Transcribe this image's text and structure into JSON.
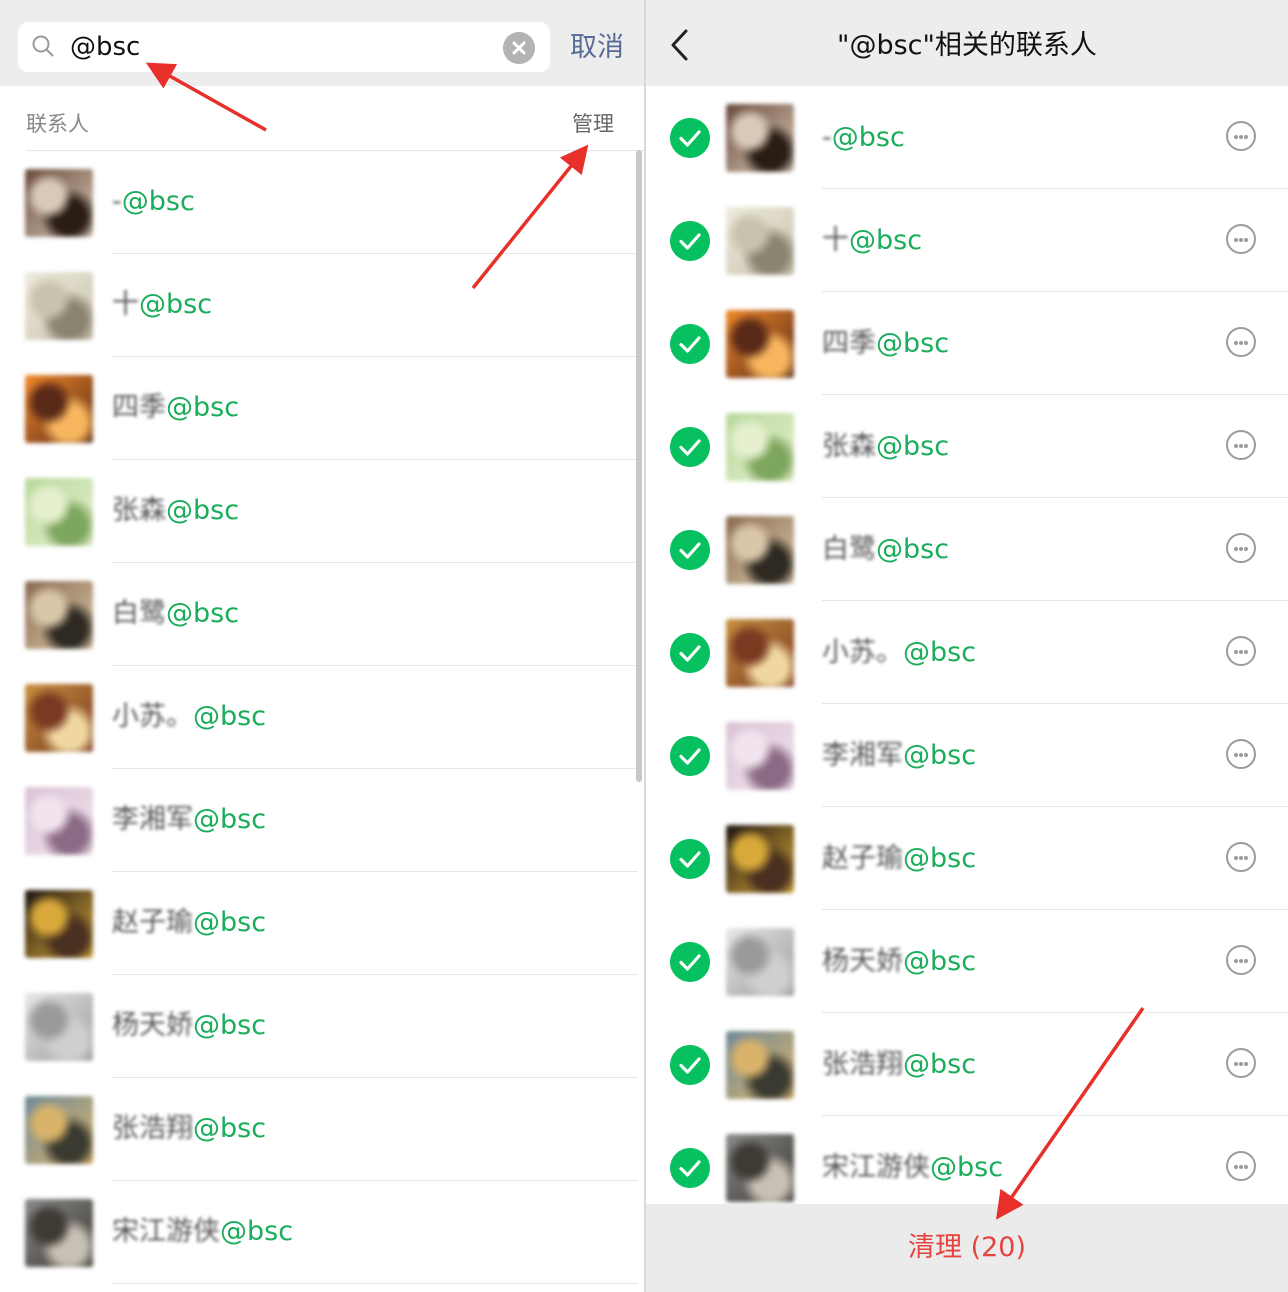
{
  "left": {
    "search": {
      "query": "@bsc",
      "cancel_label": "取消"
    },
    "section": {
      "title": "联系人",
      "manage_label": "管理"
    },
    "contacts": [
      {
        "prefix": "-",
        "match": "@bsc",
        "avatar": [
          "#6a4a3a",
          "#d8c9b8",
          "#2a1d16"
        ]
      },
      {
        "prefix": "十",
        "match": "@bsc",
        "avatar": [
          "#eeeadd",
          "#c9c3ad",
          "#8a8470"
        ]
      },
      {
        "prefix": "四季",
        "match": "@bsc",
        "avatar": [
          "#f0892a",
          "#5a2a18",
          "#f7b55e"
        ]
      },
      {
        "prefix": "张森",
        "match": "@bsc",
        "avatar": [
          "#b7d89a",
          "#e6f0cf",
          "#7da65e"
        ]
      },
      {
        "prefix": "白鹭",
        "match": "@bsc",
        "avatar": [
          "#8a6a4e",
          "#d9c7aa",
          "#2e2a22"
        ]
      },
      {
        "prefix": "小苏。",
        "match": "@bsc",
        "avatar": [
          "#c8903e",
          "#7a3a22",
          "#f0d7a0"
        ]
      },
      {
        "prefix": "李湘军",
        "match": "@bsc",
        "avatar": [
          "#d9c2d4",
          "#f2e4ee",
          "#8b6a85"
        ]
      },
      {
        "prefix": "赵子瑜",
        "match": "@bsc",
        "avatar": [
          "#1c1410",
          "#d8a93a",
          "#4a3020"
        ]
      },
      {
        "prefix": "杨天娇",
        "match": "@bsc",
        "avatar": [
          "#e8e8e8",
          "#9a9a9a",
          "#cfcfcf"
        ]
      },
      {
        "prefix": "张浩翔",
        "match": "@bsc",
        "avatar": [
          "#6f8a9a",
          "#d9b36a",
          "#3a3a30"
        ]
      },
      {
        "prefix": "宋江游侠",
        "match": "@bsc",
        "avatar": [
          "#8a8a8a",
          "#3e3a34",
          "#c7c0b4"
        ]
      }
    ]
  },
  "right": {
    "title": "\"@bsc\"相关的联系人",
    "contacts": [
      {
        "prefix": "-",
        "match": "@bsc",
        "avatar": [
          "#6a4a3a",
          "#d8c9b8",
          "#2a1d16"
        ]
      },
      {
        "prefix": "十",
        "match": "@bsc",
        "avatar": [
          "#eeeadd",
          "#c9c3ad",
          "#8a8470"
        ]
      },
      {
        "prefix": "四季",
        "match": "@bsc",
        "avatar": [
          "#f0892a",
          "#5a2a18",
          "#f7b55e"
        ]
      },
      {
        "prefix": "张森",
        "match": "@bsc",
        "avatar": [
          "#b7d89a",
          "#e6f0cf",
          "#7da65e"
        ]
      },
      {
        "prefix": "白鹭",
        "match": "@bsc",
        "avatar": [
          "#8a6a4e",
          "#d9c7aa",
          "#2e2a22"
        ]
      },
      {
        "prefix": "小苏。",
        "match": "@bsc",
        "avatar": [
          "#c8903e",
          "#7a3a22",
          "#f0d7a0"
        ]
      },
      {
        "prefix": "李湘军",
        "match": "@bsc",
        "avatar": [
          "#d9c2d4",
          "#f2e4ee",
          "#8b6a85"
        ]
      },
      {
        "prefix": "赵子瑜",
        "match": "@bsc",
        "avatar": [
          "#1c1410",
          "#d8a93a",
          "#4a3020"
        ]
      },
      {
        "prefix": "杨天娇",
        "match": "@bsc",
        "avatar": [
          "#e8e8e8",
          "#9a9a9a",
          "#cfcfcf"
        ]
      },
      {
        "prefix": "张浩翔",
        "match": "@bsc",
        "avatar": [
          "#6f8a9a",
          "#d9b36a",
          "#3a3a30"
        ]
      },
      {
        "prefix": "宋江游侠",
        "match": "@bsc",
        "avatar": [
          "#8a8a8a",
          "#3e3a34",
          "#c7c0b4"
        ]
      }
    ],
    "clean_label": "清理 (20)"
  },
  "colors": {
    "match_green": "#1aad5b",
    "check_green": "#07c160",
    "cancel_blue": "#576b95",
    "clean_red": "#e64340",
    "arrow_red": "#e8302a"
  },
  "icons": {
    "search": "search-icon",
    "clear": "clear-icon",
    "back": "back-arrow-icon",
    "check": "check-circle-icon",
    "more": "more-dots-icon"
  }
}
